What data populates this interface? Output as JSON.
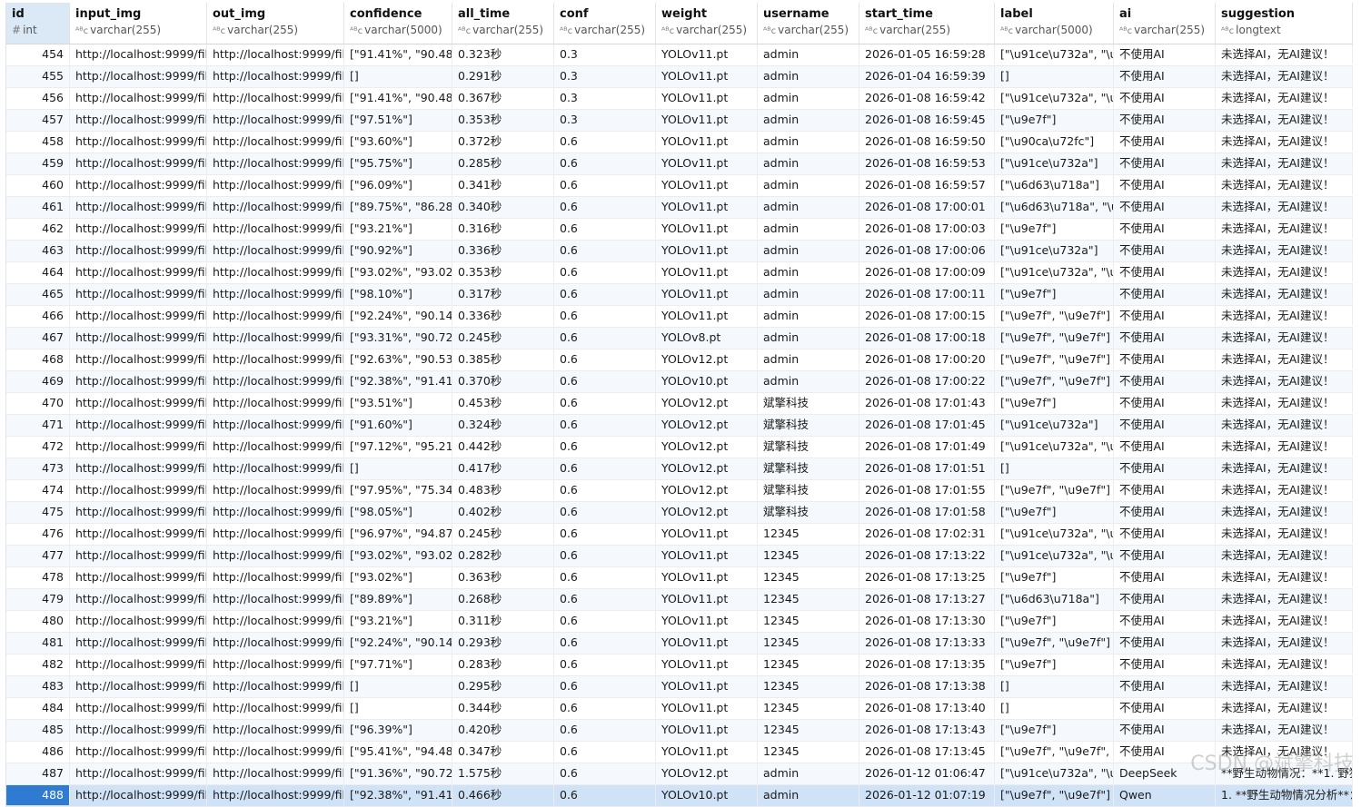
{
  "columns": [
    {
      "name": "id",
      "type": "int",
      "icon": "number-type-icon"
    },
    {
      "name": "input_img",
      "type": "varchar(255)",
      "icon": "text-type-icon"
    },
    {
      "name": "out_img",
      "type": "varchar(255)",
      "icon": "text-type-icon"
    },
    {
      "name": "confidence",
      "type": "varchar(5000)",
      "icon": "text-type-icon"
    },
    {
      "name": "all_time",
      "type": "varchar(255)",
      "icon": "text-type-icon"
    },
    {
      "name": "conf",
      "type": "varchar(255)",
      "icon": "text-type-icon"
    },
    {
      "name": "weight",
      "type": "varchar(255)",
      "icon": "text-type-icon"
    },
    {
      "name": "username",
      "type": "varchar(255)",
      "icon": "text-type-icon"
    },
    {
      "name": "start_time",
      "type": "varchar(255)",
      "icon": "text-type-icon"
    },
    {
      "name": "label",
      "type": "varchar(5000)",
      "icon": "text-type-icon"
    },
    {
      "name": "ai",
      "type": "varchar(255)",
      "icon": "text-type-icon"
    },
    {
      "name": "suggestion",
      "type": "longtext",
      "icon": "text-type-icon"
    }
  ],
  "type_icons": {
    "number": "#",
    "text": "ᴬᴮc"
  },
  "selected_row_id": "488",
  "rows": [
    [
      "454",
      "http://localhost:9999/file",
      "http://localhost:9999/file",
      "[\"91.41%\", \"90.48%",
      "0.323秒",
      "0.3",
      "YOLOv11.pt",
      "admin",
      "2026-01-05 16:59:28",
      "[\"\\u91ce\\u732a\", \"\\u",
      "不使用AI",
      "未选择AI，无AI建议！"
    ],
    [
      "455",
      "http://localhost:9999/file",
      "http://localhost:9999/file",
      "[]",
      "0.291秒",
      "0.3",
      "YOLOv11.pt",
      "admin",
      "2026-01-04 16:59:39",
      "[]",
      "不使用AI",
      "未选择AI，无AI建议！"
    ],
    [
      "456",
      "http://localhost:9999/file",
      "http://localhost:9999/file",
      "[\"91.41%\", \"90.48%",
      "0.367秒",
      "0.3",
      "YOLOv11.pt",
      "admin",
      "2026-01-08 16:59:42",
      "[\"\\u91ce\\u732a\", \"\\u",
      "不使用AI",
      "未选择AI，无AI建议！"
    ],
    [
      "457",
      "http://localhost:9999/file",
      "http://localhost:9999/file",
      "[\"97.51%\"]",
      "0.353秒",
      "0.3",
      "YOLOv11.pt",
      "admin",
      "2026-01-08 16:59:45",
      "[\"\\u9e7f\"]",
      "不使用AI",
      "未选择AI，无AI建议！"
    ],
    [
      "458",
      "http://localhost:9999/file",
      "http://localhost:9999/file",
      "[\"93.60%\"]",
      "0.372秒",
      "0.6",
      "YOLOv11.pt",
      "admin",
      "2026-01-08 16:59:50",
      "[\"\\u90ca\\u72fc\"]",
      "不使用AI",
      "未选择AI，无AI建议！"
    ],
    [
      "459",
      "http://localhost:9999/file",
      "http://localhost:9999/file",
      "[\"95.75%\"]",
      "0.285秒",
      "0.6",
      "YOLOv11.pt",
      "admin",
      "2026-01-08 16:59:53",
      "[\"\\u91ce\\u732a\"]",
      "不使用AI",
      "未选择AI，无AI建议！"
    ],
    [
      "460",
      "http://localhost:9999/file",
      "http://localhost:9999/file",
      "[\"96.09%\"]",
      "0.341秒",
      "0.6",
      "YOLOv11.pt",
      "admin",
      "2026-01-08 16:59:57",
      "[\"\\u6d63\\u718a\"]",
      "不使用AI",
      "未选择AI，无AI建议！"
    ],
    [
      "461",
      "http://localhost:9999/file",
      "http://localhost:9999/file",
      "[\"89.75%\", \"86.28%",
      "0.340秒",
      "0.6",
      "YOLOv11.pt",
      "admin",
      "2026-01-08 17:00:01",
      "[\"\\u6d63\\u718a\", \"\\u",
      "不使用AI",
      "未选择AI，无AI建议！"
    ],
    [
      "462",
      "http://localhost:9999/file",
      "http://localhost:9999/file",
      "[\"93.21%\"]",
      "0.316秒",
      "0.6",
      "YOLOv11.pt",
      "admin",
      "2026-01-08 17:00:03",
      "[\"\\u9e7f\"]",
      "不使用AI",
      "未选择AI，无AI建议！"
    ],
    [
      "463",
      "http://localhost:9999/file",
      "http://localhost:9999/file",
      "[\"90.92%\"]",
      "0.336秒",
      "0.6",
      "YOLOv11.pt",
      "admin",
      "2026-01-08 17:00:06",
      "[\"\\u91ce\\u732a\"]",
      "不使用AI",
      "未选择AI，无AI建议！"
    ],
    [
      "464",
      "http://localhost:9999/file",
      "http://localhost:9999/file",
      "[\"93.02%\", \"93.02%",
      "0.353秒",
      "0.6",
      "YOLOv11.pt",
      "admin",
      "2026-01-08 17:00:09",
      "[\"\\u91ce\\u732a\", \"\\u",
      "不使用AI",
      "未选择AI，无AI建议！"
    ],
    [
      "465",
      "http://localhost:9999/file",
      "http://localhost:9999/file",
      "[\"98.10%\"]",
      "0.317秒",
      "0.6",
      "YOLOv11.pt",
      "admin",
      "2026-01-08 17:00:11",
      "[\"\\u9e7f\"]",
      "不使用AI",
      "未选择AI，无AI建议！"
    ],
    [
      "466",
      "http://localhost:9999/file",
      "http://localhost:9999/file",
      "[\"92.24%\", \"90.14%",
      "0.336秒",
      "0.6",
      "YOLOv11.pt",
      "admin",
      "2026-01-08 17:00:15",
      "[\"\\u9e7f\", \"\\u9e7f\"]",
      "不使用AI",
      "未选择AI，无AI建议！"
    ],
    [
      "467",
      "http://localhost:9999/file",
      "http://localhost:9999/file",
      "[\"93.31%\", \"90.72%",
      "0.245秒",
      "0.6",
      "YOLOv8.pt",
      "admin",
      "2026-01-08 17:00:18",
      "[\"\\u9e7f\", \"\\u9e7f\"]",
      "不使用AI",
      "未选择AI，无AI建议！"
    ],
    [
      "468",
      "http://localhost:9999/file",
      "http://localhost:9999/file",
      "[\"92.63%\", \"90.53%",
      "0.385秒",
      "0.6",
      "YOLOv12.pt",
      "admin",
      "2026-01-08 17:00:20",
      "[\"\\u9e7f\", \"\\u9e7f\"]",
      "不使用AI",
      "未选择AI，无AI建议！"
    ],
    [
      "469",
      "http://localhost:9999/file",
      "http://localhost:9999/file",
      "[\"92.38%\", \"91.41%",
      "0.370秒",
      "0.6",
      "YOLOv10.pt",
      "admin",
      "2026-01-08 17:00:22",
      "[\"\\u9e7f\", \"\\u9e7f\"]",
      "不使用AI",
      "未选择AI，无AI建议！"
    ],
    [
      "470",
      "http://localhost:9999/file",
      "http://localhost:9999/file",
      "[\"93.51%\"]",
      "0.453秒",
      "0.6",
      "YOLOv12.pt",
      "斌擎科技",
      "2026-01-08 17:01:43",
      "[\"\\u9e7f\"]",
      "不使用AI",
      "未选择AI，无AI建议！"
    ],
    [
      "471",
      "http://localhost:9999/file",
      "http://localhost:9999/file",
      "[\"91.60%\"]",
      "0.324秒",
      "0.6",
      "YOLOv12.pt",
      "斌擎科技",
      "2026-01-08 17:01:45",
      "[\"\\u91ce\\u732a\"]",
      "不使用AI",
      "未选择AI，无AI建议！"
    ],
    [
      "472",
      "http://localhost:9999/file",
      "http://localhost:9999/file",
      "[\"97.12%\", \"95.21%",
      "0.442秒",
      "0.6",
      "YOLOv12.pt",
      "斌擎科技",
      "2026-01-08 17:01:49",
      "[\"\\u91ce\\u732a\", \"\\u",
      "不使用AI",
      "未选择AI，无AI建议！"
    ],
    [
      "473",
      "http://localhost:9999/file",
      "http://localhost:9999/file",
      "[]",
      "0.417秒",
      "0.6",
      "YOLOv12.pt",
      "斌擎科技",
      "2026-01-08 17:01:51",
      "[]",
      "不使用AI",
      "未选择AI，无AI建议！"
    ],
    [
      "474",
      "http://localhost:9999/file",
      "http://localhost:9999/file",
      "[\"97.95%\", \"75.34%",
      "0.483秒",
      "0.6",
      "YOLOv12.pt",
      "斌擎科技",
      "2026-01-08 17:01:55",
      "[\"\\u9e7f\", \"\\u9e7f\"]",
      "不使用AI",
      "未选择AI，无AI建议！"
    ],
    [
      "475",
      "http://localhost:9999/file",
      "http://localhost:9999/file",
      "[\"98.05%\"]",
      "0.402秒",
      "0.6",
      "YOLOv12.pt",
      "斌擎科技",
      "2026-01-08 17:01:58",
      "[\"\\u9e7f\"]",
      "不使用AI",
      "未选择AI，无AI建议！"
    ],
    [
      "476",
      "http://localhost:9999/file",
      "http://localhost:9999/file",
      "[\"96.97%\", \"94.87%",
      "0.245秒",
      "0.6",
      "YOLOv11.pt",
      "12345",
      "2026-01-08 17:02:31",
      "[\"\\u91ce\\u732a\", \"\\u",
      "不使用AI",
      "未选择AI，无AI建议！"
    ],
    [
      "477",
      "http://localhost:9999/file",
      "http://localhost:9999/file",
      "[\"93.02%\", \"93.02%",
      "0.282秒",
      "0.6",
      "YOLOv11.pt",
      "12345",
      "2026-01-08 17:13:22",
      "[\"\\u91ce\\u732a\", \"\\u",
      "不使用AI",
      "未选择AI，无AI建议！"
    ],
    [
      "478",
      "http://localhost:9999/file",
      "http://localhost:9999/file",
      "[\"93.02%\"]",
      "0.363秒",
      "0.6",
      "YOLOv11.pt",
      "12345",
      "2026-01-08 17:13:25",
      "[\"\\u9e7f\"]",
      "不使用AI",
      "未选择AI，无AI建议！"
    ],
    [
      "479",
      "http://localhost:9999/file",
      "http://localhost:9999/file",
      "[\"89.89%\"]",
      "0.268秒",
      "0.6",
      "YOLOv11.pt",
      "12345",
      "2026-01-08 17:13:27",
      "[\"\\u6d63\\u718a\"]",
      "不使用AI",
      "未选择AI，无AI建议！"
    ],
    [
      "480",
      "http://localhost:9999/file",
      "http://localhost:9999/file",
      "[\"93.21%\"]",
      "0.311秒",
      "0.6",
      "YOLOv11.pt",
      "12345",
      "2026-01-08 17:13:30",
      "[\"\\u9e7f\"]",
      "不使用AI",
      "未选择AI，无AI建议！"
    ],
    [
      "481",
      "http://localhost:9999/file",
      "http://localhost:9999/file",
      "[\"92.24%\", \"90.14%",
      "0.293秒",
      "0.6",
      "YOLOv11.pt",
      "12345",
      "2026-01-08 17:13:33",
      "[\"\\u9e7f\", \"\\u9e7f\"]",
      "不使用AI",
      "未选择AI，无AI建议！"
    ],
    [
      "482",
      "http://localhost:9999/file",
      "http://localhost:9999/file",
      "[\"97.71%\"]",
      "0.283秒",
      "0.6",
      "YOLOv11.pt",
      "12345",
      "2026-01-08 17:13:35",
      "[\"\\u9e7f\"]",
      "不使用AI",
      "未选择AI，无AI建议！"
    ],
    [
      "483",
      "http://localhost:9999/file",
      "http://localhost:9999/file",
      "[]",
      "0.295秒",
      "0.6",
      "YOLOv11.pt",
      "12345",
      "2026-01-08 17:13:38",
      "[]",
      "不使用AI",
      "未选择AI，无AI建议！"
    ],
    [
      "484",
      "http://localhost:9999/file",
      "http://localhost:9999/file",
      "[]",
      "0.344秒",
      "0.6",
      "YOLOv11.pt",
      "12345",
      "2026-01-08 17:13:40",
      "[]",
      "不使用AI",
      "未选择AI，无AI建议！"
    ],
    [
      "485",
      "http://localhost:9999/file",
      "http://localhost:9999/file",
      "[\"96.39%\"]",
      "0.420秒",
      "0.6",
      "YOLOv11.pt",
      "12345",
      "2026-01-08 17:13:43",
      "[\"\\u9e7f\"]",
      "不使用AI",
      "未选择AI，无AI建议！"
    ],
    [
      "486",
      "http://localhost:9999/file",
      "http://localhost:9999/file",
      "[\"95.41%\", \"94.48%",
      "0.347秒",
      "0.6",
      "YOLOv11.pt",
      "12345",
      "2026-01-08 17:13:45",
      "[\"\\u9e7f\", \"\\u9e7f\", \"\\",
      "不使用AI",
      "未选择AI，无AI建议！"
    ],
    [
      "487",
      "http://localhost:9999/file",
      "http://localhost:9999/file",
      "[\"91.36%\", \"90.72%",
      "1.575秒",
      "0.6",
      "YOLOv12.pt",
      "admin",
      "2026-01-12 01:06:47",
      "[\"\\u91ce\\u732a\", \"\\u",
      "DeepSeek",
      "**野生动物情况：**1. 野猪"
    ],
    [
      "488",
      "http://localhost:9999/file",
      "http://localhost:9999/file",
      "[\"92.38%\", \"91.41%",
      "0.466秒",
      "0.6",
      "YOLOv10.pt",
      "admin",
      "2026-01-12 01:07:19",
      "[\"\\u9e7f\", \"\\u9e7f\"]",
      "Qwen",
      "1. **野生动物情况分析**："
    ]
  ],
  "watermark": "CSDN @斌擎科技"
}
